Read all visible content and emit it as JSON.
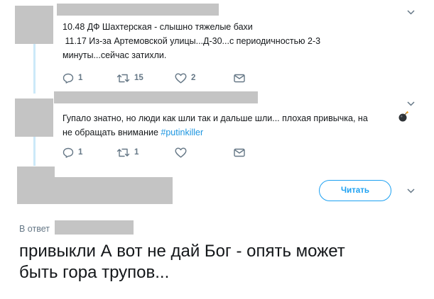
{
  "tweets": [
    {
      "lines": [
        "10.48 ДФ Шахтерская - слышно тяжелые бахи",
        " 11.17 Из-за Артемовской улицы...Д-30...с периодичностью 2-3",
        "минуты...сейчас затихли."
      ],
      "actions": {
        "reply_count": "1",
        "retweet_count": "15",
        "like_count": "2"
      }
    },
    {
      "line1": "Гупало знатно, но люди как шли так и дальше шли... плохая привычка, на",
      "line2": "не обращать внимание ",
      "hashtag": "#putinkiller",
      "actions": {
        "reply_count": "1",
        "retweet_count": "1",
        "like_count": ""
      }
    }
  ],
  "main_tweet": {
    "follow_label": "Читать",
    "reply_to_prefix": "В ответ",
    "lines": [
      "привыкли А вот не дай Бог - опять может",
      "быть гора трупов..."
    ]
  },
  "colors": {
    "accent": "#1da1f2",
    "hashtag": "#1b95e0",
    "muted": "#657786",
    "thread_line": "#cce9f9",
    "redaction": "#c4c4c4"
  },
  "icons": [
    "reply-icon",
    "retweet-icon",
    "like-icon",
    "direct-message-icon",
    "chevron-down-icon",
    "bomb-emoji-icon"
  ]
}
